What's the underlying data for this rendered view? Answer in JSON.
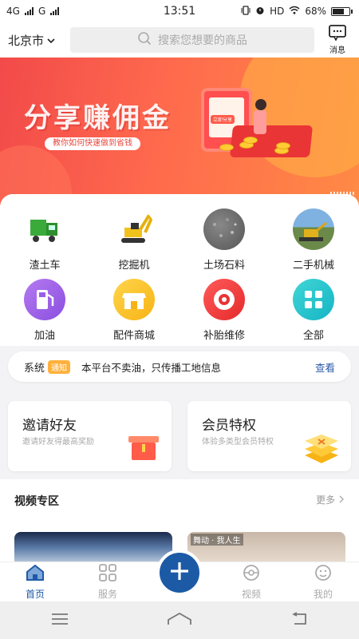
{
  "status_bar": {
    "network_1": "4G",
    "network_2": "G",
    "time": "13:51",
    "hd": "HD",
    "battery_text": "68%",
    "battery_level": 0.68
  },
  "header": {
    "city": "北京市",
    "search_placeholder": "搜索您想要的商品",
    "message_label": "消息"
  },
  "banner": {
    "title": "分享赚佣金",
    "subtitle": "教你如何快速做到省钱",
    "phone_tag": "立即分享"
  },
  "categories": [
    {
      "label": "渣土车",
      "icon": "dump-truck-icon"
    },
    {
      "label": "挖掘机",
      "icon": "excavator-icon"
    },
    {
      "label": "土场石料",
      "icon": "gravel-icon"
    },
    {
      "label": "二手机械",
      "icon": "used-machinery-icon"
    },
    {
      "label": "加油",
      "icon": "fuel-pump-icon"
    },
    {
      "label": "配件商城",
      "icon": "shop-icon"
    },
    {
      "label": "补胎维修",
      "icon": "tire-repair-icon"
    },
    {
      "label": "全部",
      "icon": "grid-all-icon"
    }
  ],
  "notice": {
    "label": "系统",
    "badge": "通知",
    "text": "本平台不卖油，只传播工地信息",
    "action": "查看"
  },
  "promos": [
    {
      "title": "邀请好友",
      "subtitle": "邀请好友得最高奖励",
      "icon": "gift-box-icon"
    },
    {
      "title": "会员特权",
      "subtitle": "体验多类型会员特权",
      "icon": "member-layers-icon"
    }
  ],
  "videos": {
    "title": "视频专区",
    "more": "更多",
    "items": [
      {
        "caption": ""
      },
      {
        "caption": "舞动 · 我人生"
      }
    ]
  },
  "tabbar": [
    {
      "label": "首页",
      "icon": "home-icon",
      "active": true
    },
    {
      "label": "服务",
      "icon": "services-grid-icon",
      "active": false
    },
    {
      "label": "视频",
      "icon": "video-icon",
      "active": false
    },
    {
      "label": "我的",
      "icon": "profile-icon",
      "active": false
    }
  ],
  "colors": {
    "accent": "#1c5aa6",
    "banner_red": "#f24a4a",
    "badge_orange": "#ffb13c"
  }
}
